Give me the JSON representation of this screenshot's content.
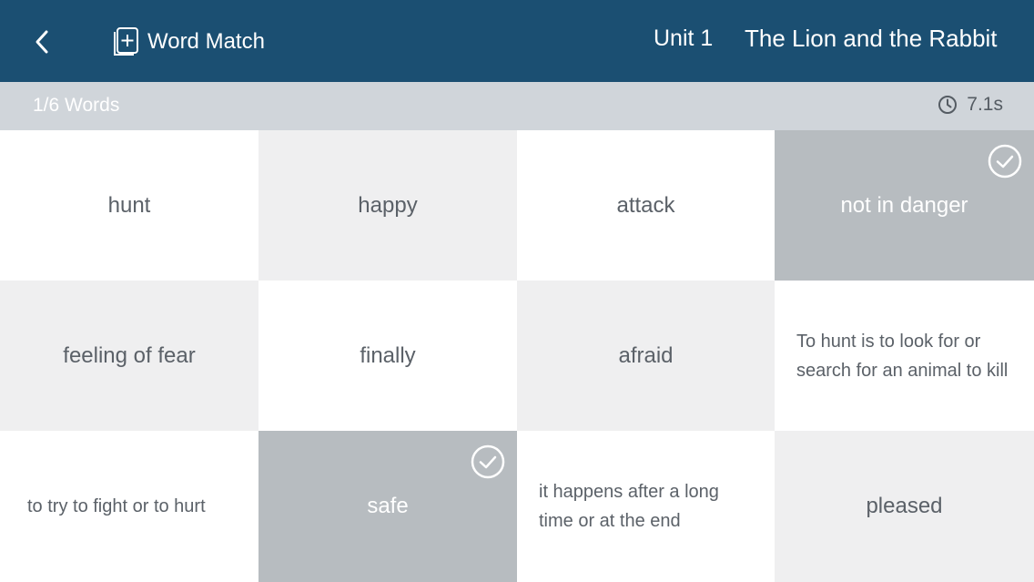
{
  "header": {
    "app_title": "Word Match",
    "unit_label": "Unit 1",
    "story_title": "The Lion and the Rabbit",
    "icons": {
      "back": "chevron-left-icon",
      "app": "add-card-icon"
    }
  },
  "status": {
    "progress": "1/6 Words",
    "timer": "7.1s",
    "timer_icon": "clock-icon"
  },
  "colors": {
    "header_bg": "#1b4f72",
    "status_bg": "#d0d5da",
    "tile_white": "#ffffff",
    "tile_light": "#efeff0",
    "tile_matched": "#b7bcc0",
    "tile_text": "#5b6168"
  },
  "tiles": [
    {
      "text": "hunt",
      "state": "default"
    },
    {
      "text": "happy",
      "state": "default"
    },
    {
      "text": "attack",
      "state": "default"
    },
    {
      "text": "not in danger",
      "state": "matched"
    },
    {
      "text": "feeling of fear",
      "state": "default"
    },
    {
      "text": "finally",
      "state": "default"
    },
    {
      "text": "afraid",
      "state": "default"
    },
    {
      "text": "To hunt is to look for or search for an animal to kill",
      "state": "default"
    },
    {
      "text": "to try to fight or to hurt",
      "state": "default"
    },
    {
      "text": "safe",
      "state": "matched"
    },
    {
      "text": "it happens after a long time or at the end",
      "state": "default"
    },
    {
      "text": "pleased",
      "state": "default"
    }
  ]
}
